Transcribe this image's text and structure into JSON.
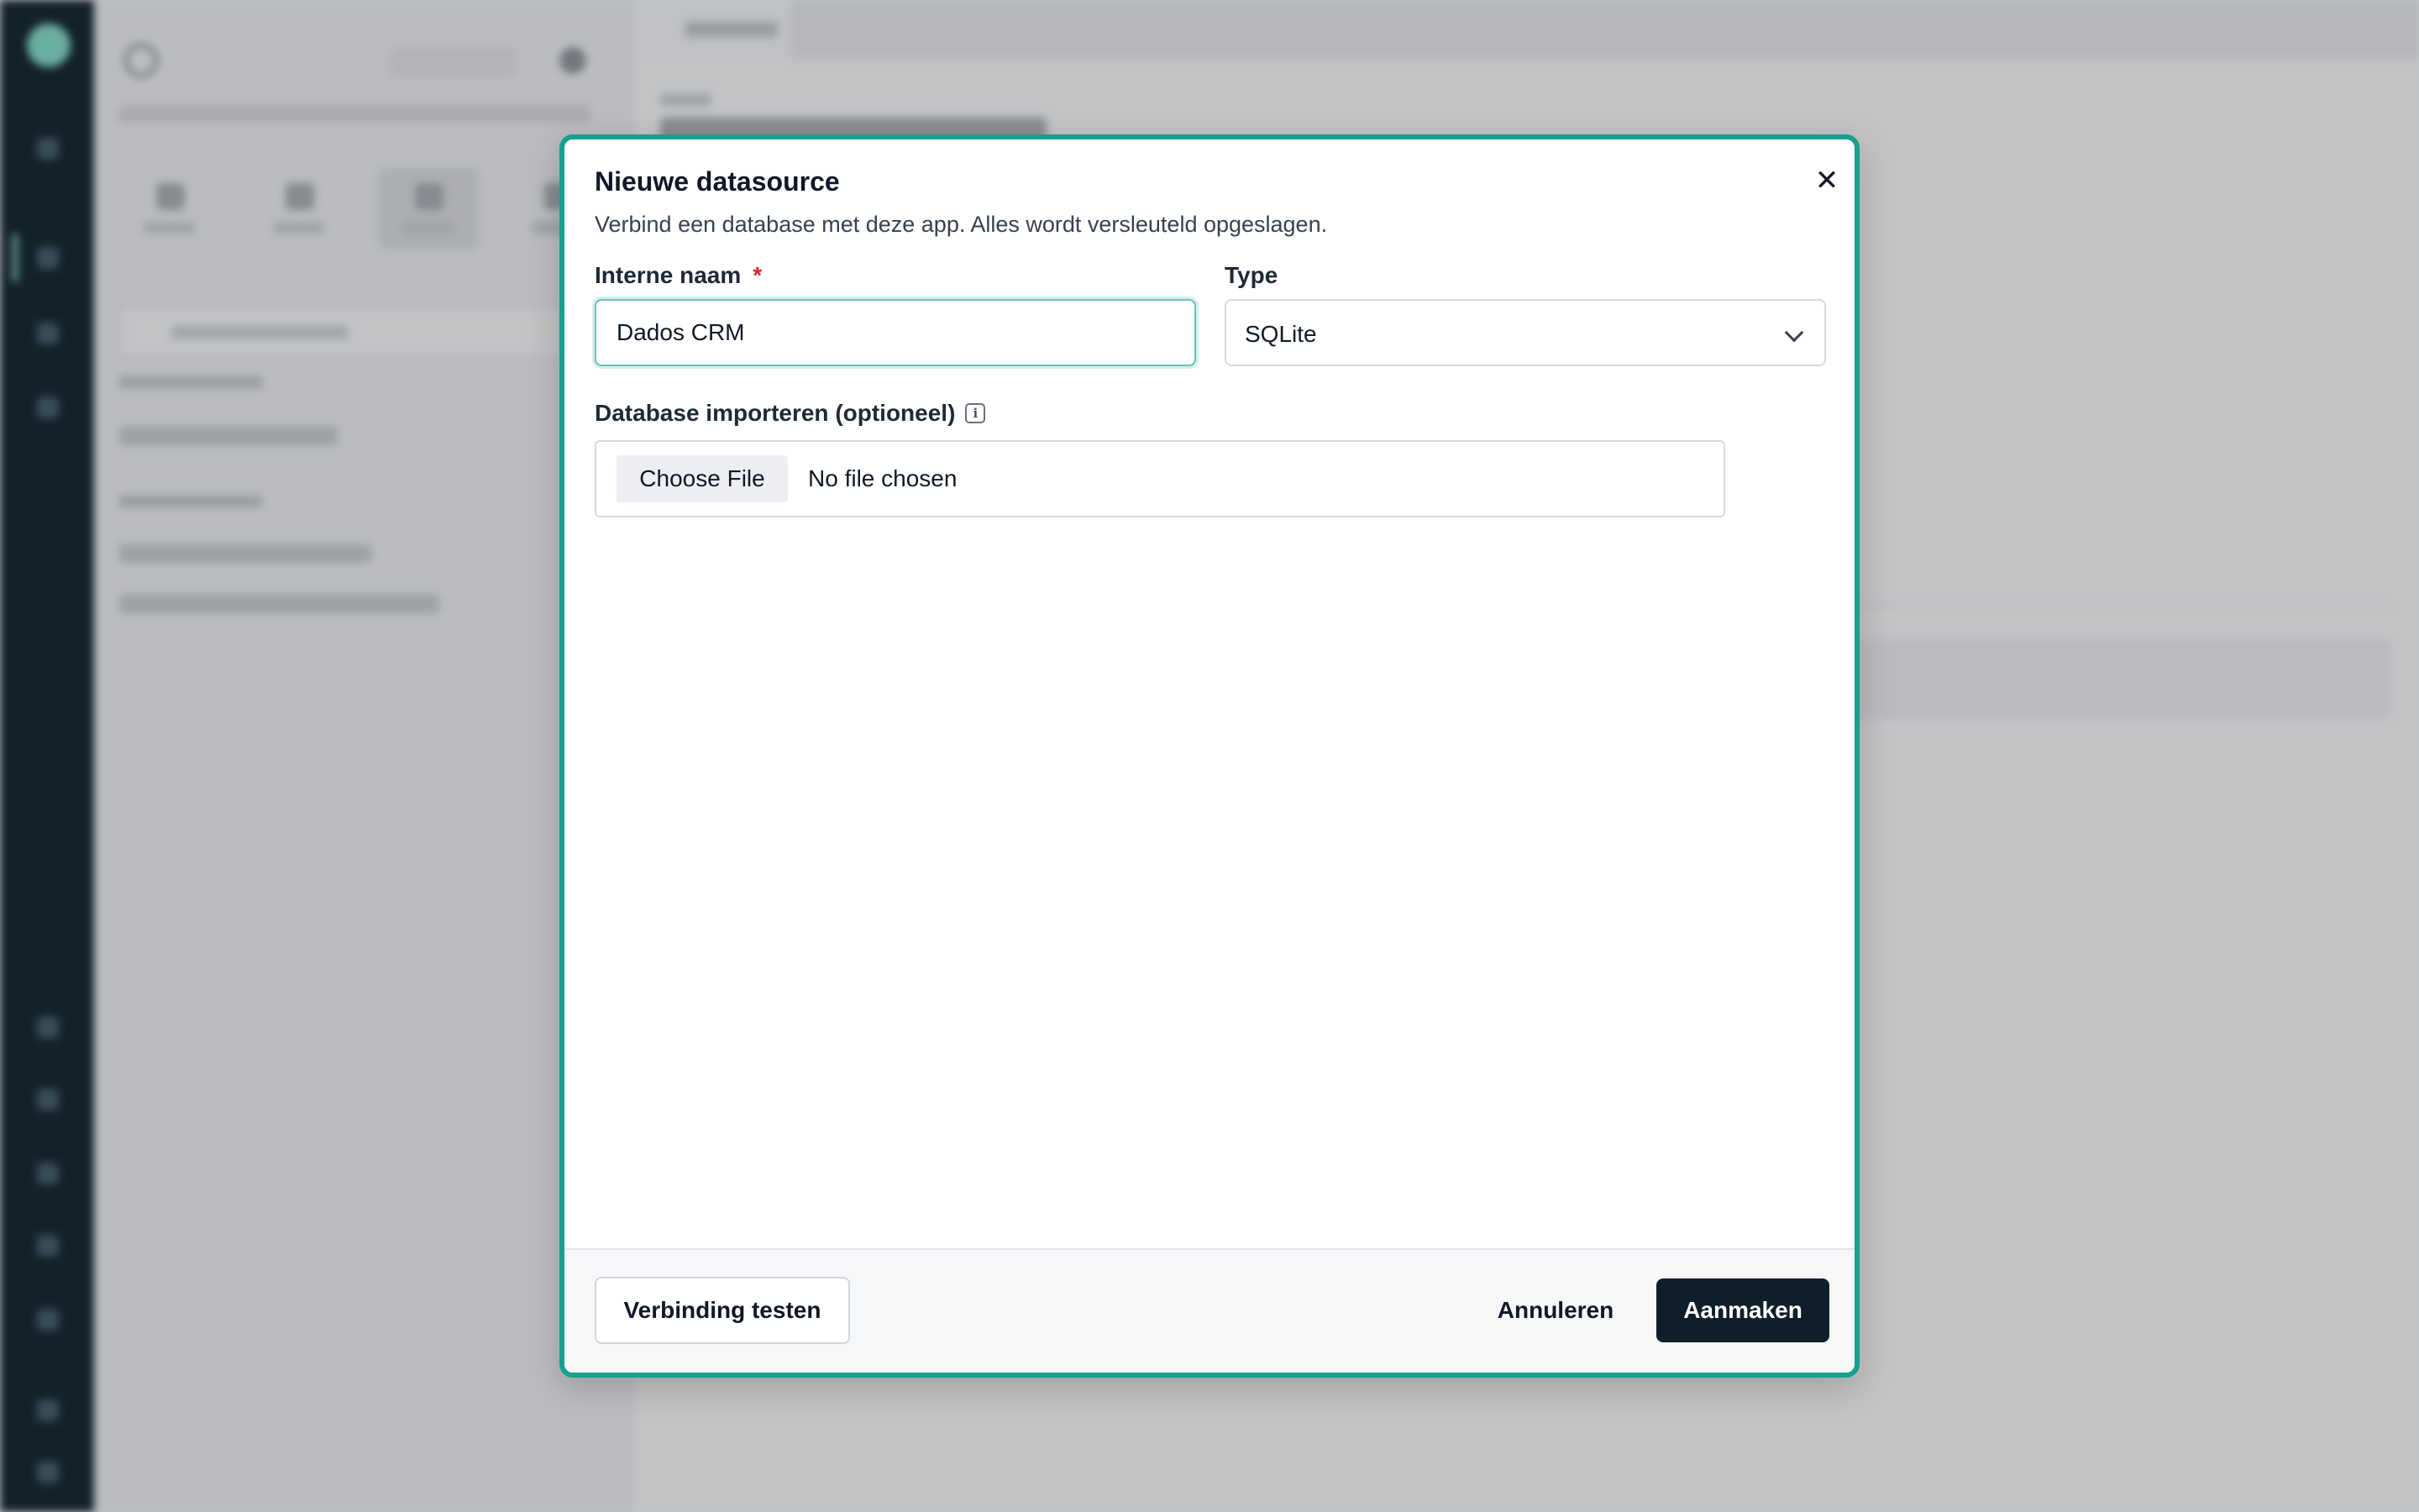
{
  "modal": {
    "title": "Nieuwe datasource",
    "subtitle": "Verbind een database met deze app. Alles wordt versleuteld opgeslagen.",
    "close_icon": "close-icon",
    "name_field": {
      "label": "Interne naam",
      "required_mark": "*",
      "value": "Dados CRM"
    },
    "type_field": {
      "label": "Type",
      "value": "SQLite"
    },
    "import_field": {
      "label": "Database importeren (optioneel)",
      "info_icon": "info-icon",
      "button_label": "Choose File",
      "status": "No file chosen"
    },
    "footer": {
      "test_label": "Verbinding testen",
      "cancel_label": "Annuleren",
      "create_label": "Aanmaken"
    }
  },
  "colors": {
    "accent": "#16a08e",
    "primary_button": "#0f1f2a",
    "required": "#dc2626",
    "rail": "#14222b"
  }
}
